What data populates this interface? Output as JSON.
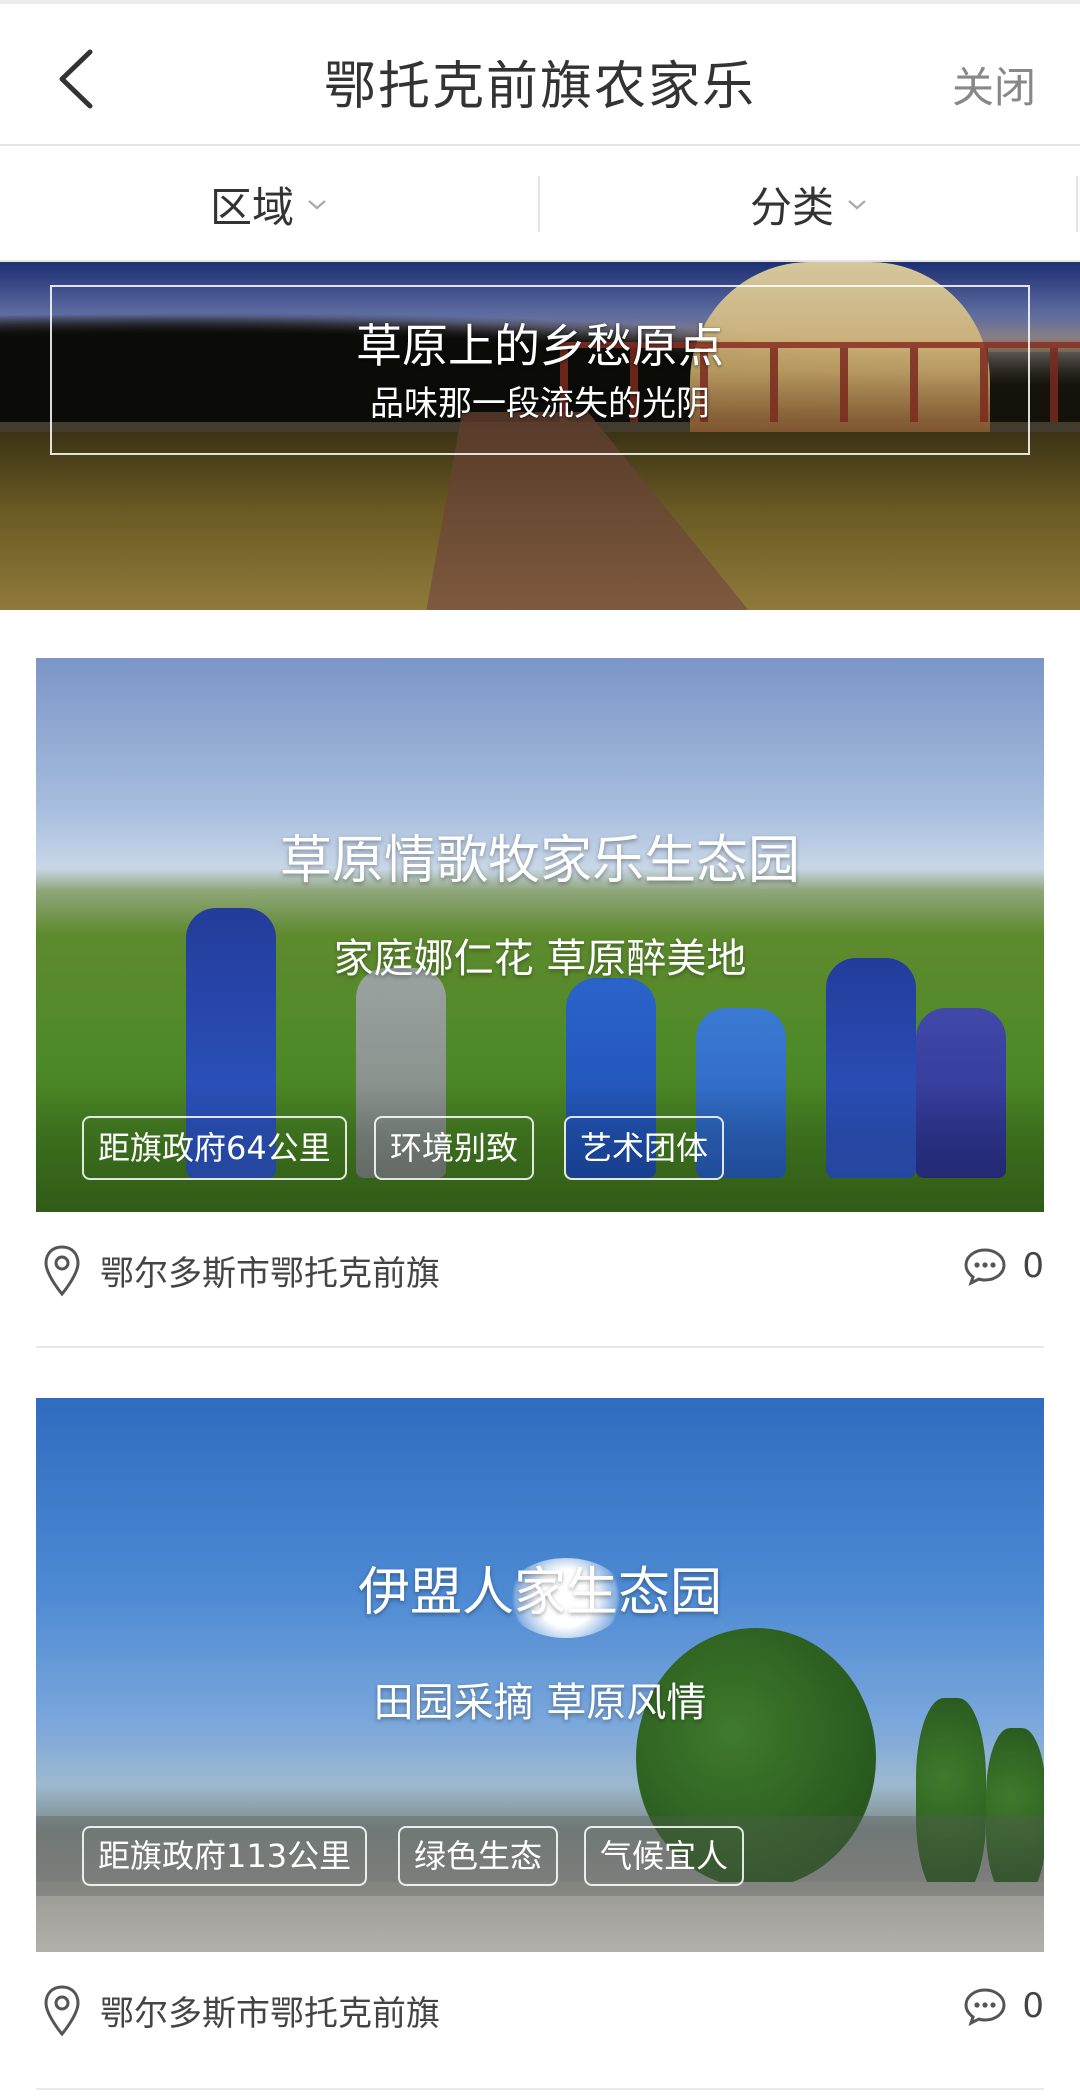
{
  "header": {
    "title": "鄂托克前旗农家乐",
    "close_label": "关闭"
  },
  "filters": [
    {
      "label": "区域"
    },
    {
      "label": "分类"
    }
  ],
  "banner": {
    "title": "草原上的乡愁原点",
    "subtitle": "品味那一段流失的光阴"
  },
  "cards": [
    {
      "title": "草原情歌牧家乐生态园",
      "subtitle": "家庭娜仁花 草原醉美地",
      "tags": [
        "距旗政府64公里",
        "环境别致",
        "艺术团体"
      ],
      "location": "鄂尔多斯市鄂托克前旗",
      "comments": "0"
    },
    {
      "title": "伊盟人家生态园",
      "subtitle": "田园采摘 草原风情",
      "tags": [
        "距旗政府113公里",
        "绿色生态",
        "气候宜人"
      ],
      "location": "鄂尔多斯市鄂托克前旗",
      "comments": "0"
    }
  ],
  "icons": {
    "back": "chevron-left-icon",
    "dropdown": "chevron-down-icon",
    "location": "map-pin-icon",
    "comment": "comment-bubble-icon"
  },
  "colors": {
    "text": "#333333",
    "muted": "#888888",
    "divider": "#e6e6e6"
  }
}
